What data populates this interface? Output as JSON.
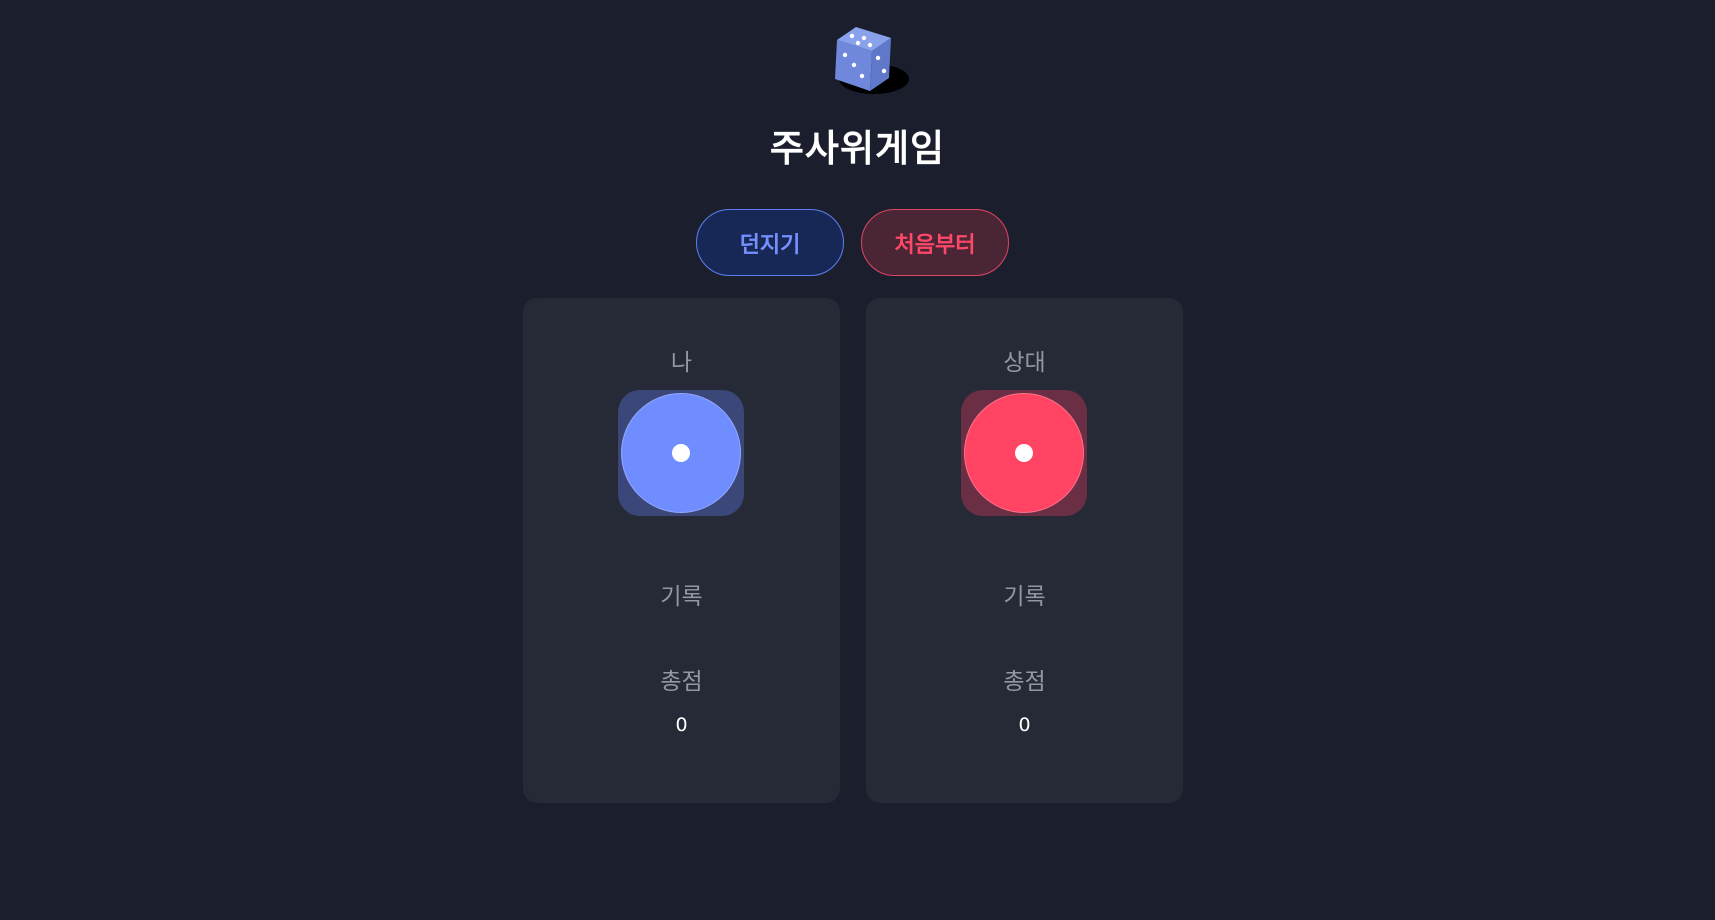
{
  "header": {
    "logo_icon": "dice-icon",
    "title": "주사위게임"
  },
  "controls": {
    "roll_label": "던지기",
    "reset_label": "처음부터"
  },
  "players": [
    {
      "name": "나",
      "die_value": 1,
      "history_label": "기록",
      "history": [],
      "total_label": "총점",
      "total": "0",
      "color": "#6f8dff"
    },
    {
      "name": "상대",
      "die_value": 1,
      "history_label": "기록",
      "history": [],
      "total_label": "총점",
      "total": "0",
      "color": "#ff4464"
    }
  ]
}
